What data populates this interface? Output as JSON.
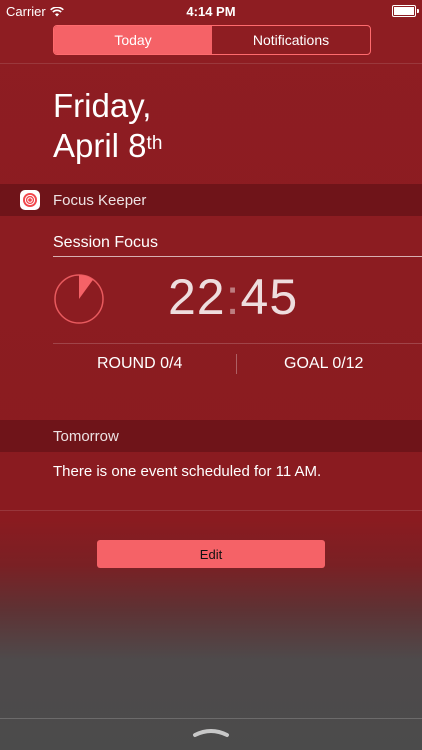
{
  "status_bar": {
    "carrier": "Carrier",
    "time": "4:14 PM"
  },
  "tabs": [
    {
      "label": "Today",
      "active": true
    },
    {
      "label": "Notifications",
      "active": false
    }
  ],
  "date": {
    "weekday": "Friday,",
    "month_day": "April 8",
    "ordinal": "th"
  },
  "widget": {
    "app_name": "Focus Keeper",
    "section_title": "Session Focus",
    "timer": {
      "minutes": "22",
      "seconds": "45",
      "progress": 0.1
    },
    "round": "ROUND 0/4",
    "goal": "GOAL 0/12"
  },
  "tomorrow": {
    "title": "Tomorrow",
    "event_text": "There is one event scheduled for 11 AM."
  },
  "edit_label": "Edit",
  "colors": {
    "accent": "#f56267",
    "background": "#8e1d22",
    "header": "#6f1419"
  }
}
